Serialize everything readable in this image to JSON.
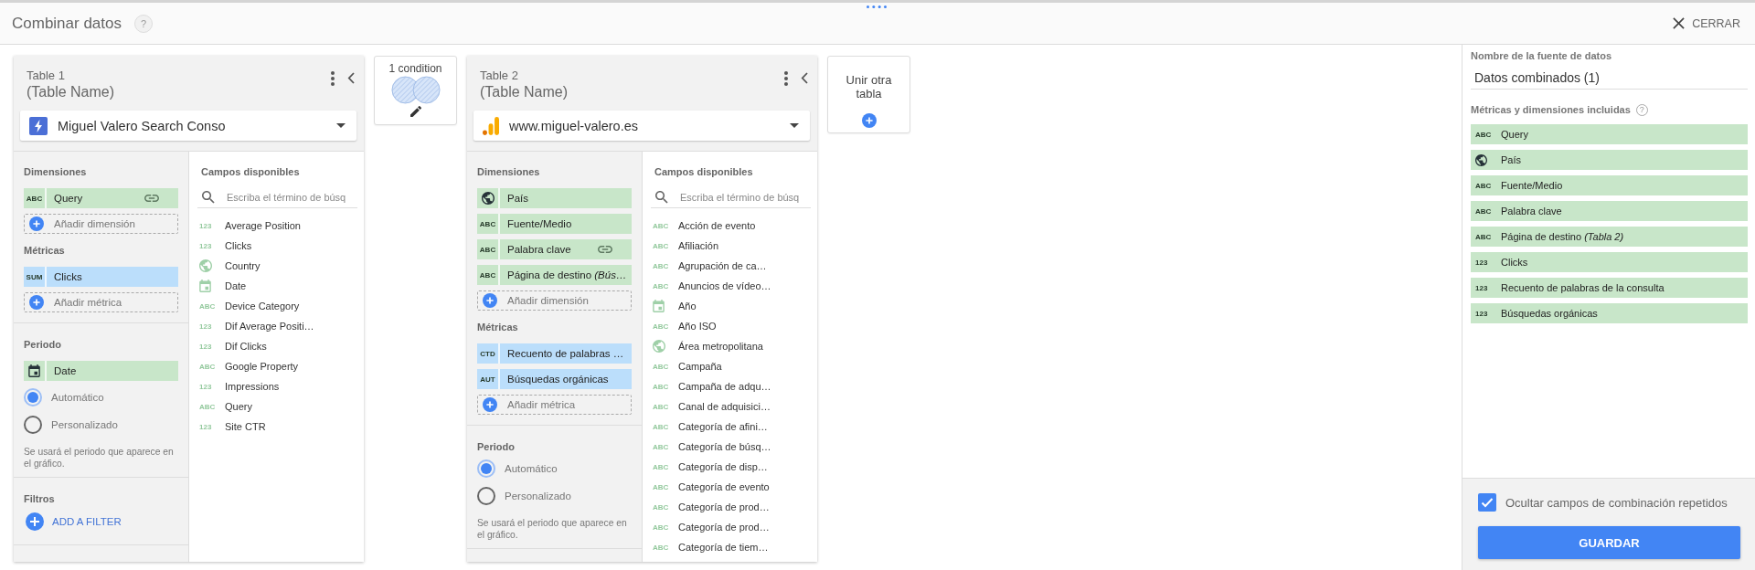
{
  "header": {
    "title": "Combinar datos",
    "help": "?",
    "close_label": "CERRAR"
  },
  "tables": [
    {
      "label": "Table 1",
      "name": "(Table Name)",
      "source": {
        "kind": "console",
        "name": "Miguel Valero Search Conso"
      },
      "dimensions": {
        "label": "Dimensiones",
        "chips": [
          {
            "kind": "tag",
            "tag": "ABC",
            "name": "Query",
            "linked": true
          }
        ],
        "add_label": "Añadir dimensión"
      },
      "metrics": {
        "label": "Métricas",
        "chips": [
          {
            "kind": "tag",
            "tag": "SUM",
            "name": "Clicks"
          }
        ],
        "add_label": "Añadir métrica"
      },
      "period": {
        "label": "Periodo",
        "chips": [
          {
            "kind": "date",
            "name": "Date"
          }
        ],
        "options": [
          {
            "label": "Automático",
            "selected": true
          },
          {
            "label": "Personalizado",
            "selected": false
          }
        ],
        "note": "Se usará el periodo que aparece en el gráfico."
      },
      "filters": {
        "label": "Filtros",
        "add_label": "ADD A FILTER"
      },
      "available": {
        "label": "Campos disponibles",
        "search": {
          "placeholder": "Escriba el término de búsq"
        },
        "fields": [
          {
            "kind": "tag",
            "tag": "123",
            "name": "Average Position"
          },
          {
            "kind": "tag",
            "tag": "123",
            "name": "Clicks"
          },
          {
            "kind": "geo",
            "name": "Country"
          },
          {
            "kind": "date",
            "name": "Date"
          },
          {
            "kind": "tag",
            "tag": "ABC",
            "name": "Device Category"
          },
          {
            "kind": "tag",
            "tag": "123",
            "name": "Dif Average Positi…"
          },
          {
            "kind": "tag",
            "tag": "123",
            "name": "Dif Clicks"
          },
          {
            "kind": "tag",
            "tag": "ABC",
            "name": "Google Property"
          },
          {
            "kind": "tag",
            "tag": "123",
            "name": "Impressions"
          },
          {
            "kind": "tag",
            "tag": "ABC",
            "name": "Query"
          },
          {
            "kind": "tag",
            "tag": "123",
            "name": "Site CTR"
          }
        ]
      }
    },
    {
      "label": "Table 2",
      "name": "(Table Name)",
      "source": {
        "kind": "analytics",
        "name": "www.miguel-valero.es"
      },
      "dimensions": {
        "label": "Dimensiones",
        "chips": [
          {
            "kind": "geo",
            "name": "País",
            "linked": false
          },
          {
            "kind": "tag",
            "tag": "ABC",
            "name": "Fuente/Medio",
            "linked": false
          },
          {
            "kind": "tag",
            "tag": "ABC",
            "name": "Palabra clave",
            "linked": true
          },
          {
            "kind": "tag",
            "tag": "ABC",
            "name": "Página de destino *(Bús…*",
            "linked": false
          }
        ],
        "add_label": "Añadir dimensión"
      },
      "metrics": {
        "label": "Métricas",
        "chips": [
          {
            "kind": "tag",
            "tag": "CTD",
            "name": "Recuento de palabras …"
          },
          {
            "kind": "tag",
            "tag": "AUT",
            "name": "Búsquedas orgánicas"
          }
        ],
        "add_label": "Añadir métrica"
      },
      "period": {
        "label": "Periodo",
        "options": [
          {
            "label": "Automático",
            "selected": true
          },
          {
            "label": "Personalizado",
            "selected": false
          }
        ],
        "note": "Se usará el periodo que aparece en el gráfico."
      },
      "available": {
        "label": "Campos disponibles",
        "search": {
          "placeholder": "Escriba el término de búsq"
        },
        "fields": [
          {
            "kind": "tag",
            "tag": "ABC",
            "name": "Acción de evento"
          },
          {
            "kind": "tag",
            "tag": "ABC",
            "name": "Afiliación"
          },
          {
            "kind": "tag",
            "tag": "ABC",
            "name": "Agrupación de ca…"
          },
          {
            "kind": "tag",
            "tag": "ABC",
            "name": "Anuncios de vídeo…"
          },
          {
            "kind": "date",
            "name": "Año"
          },
          {
            "kind": "tag",
            "tag": "ABC",
            "name": "Año ISO"
          },
          {
            "kind": "geo",
            "name": "Área metropolitana"
          },
          {
            "kind": "tag",
            "tag": "ABC",
            "name": "Campaña"
          },
          {
            "kind": "tag",
            "tag": "ABC",
            "name": "Campaña de adqu…"
          },
          {
            "kind": "tag",
            "tag": "ABC",
            "name": "Canal de adquisici…"
          },
          {
            "kind": "tag",
            "tag": "ABC",
            "name": "Categoría de afini…"
          },
          {
            "kind": "tag",
            "tag": "ABC",
            "name": "Categoría de búsq…"
          },
          {
            "kind": "tag",
            "tag": "ABC",
            "name": "Categoría de disp…"
          },
          {
            "kind": "tag",
            "tag": "ABC",
            "name": "Categoría de evento"
          },
          {
            "kind": "tag",
            "tag": "ABC",
            "name": "Categoría de prod…"
          },
          {
            "kind": "tag",
            "tag": "ABC",
            "name": "Categoría de prod…"
          },
          {
            "kind": "tag",
            "tag": "ABC",
            "name": "Categoría de tiem…"
          }
        ]
      }
    }
  ],
  "joins": [
    {
      "label": "1 condition"
    }
  ],
  "add_table": {
    "label": "Unir otra tabla"
  },
  "sidebar": {
    "name_label": "Nombre de la fuente de datos",
    "name_field": {
      "value": "Datos combinados (1)"
    },
    "included_label": "Métricas y dimensiones incluidas",
    "help": "?",
    "fields": [
      {
        "kind": "tag",
        "tag": "ABC",
        "name": "Query"
      },
      {
        "kind": "geo",
        "name": "País"
      },
      {
        "kind": "tag",
        "tag": "ABC",
        "name": "Fuente/Medio"
      },
      {
        "kind": "tag",
        "tag": "ABC",
        "name": "Palabra clave"
      },
      {
        "kind": "tag",
        "tag": "ABC",
        "name": "Página de destino *(Tabla 2)*"
      },
      {
        "kind": "tag",
        "tag": "123",
        "name": "Clicks"
      },
      {
        "kind": "tag",
        "tag": "123",
        "name": "Recuento de palabras de la consulta"
      },
      {
        "kind": "tag",
        "tag": "123",
        "name": "Búsquedas orgánicas"
      }
    ],
    "hide_repeated": {
      "label": "Ocultar campos de combinación repetidos",
      "checked": true
    },
    "save": "GUARDAR"
  }
}
